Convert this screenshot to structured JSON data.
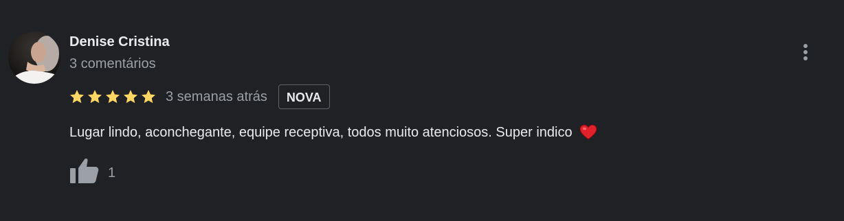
{
  "review": {
    "author_name": "Denise Cristina",
    "author_meta": "3 comentários",
    "rating": 5,
    "date": "3 semanas atrás",
    "badge": "NOVA",
    "text": "Lugar lindo, aconchegante, equipe receptiva, todos muito atenciosos. Super indico",
    "text_emoji": "heart-icon",
    "like_count": "1"
  },
  "colors": {
    "background": "#202124",
    "primary_text": "#e8eaed",
    "secondary_text": "#9aa0a6",
    "star": "#fdd663",
    "heart": "#e0202a",
    "badge_border": "#5f6368"
  },
  "icons": {
    "more": "more-vert-icon",
    "like": "thumbs-up-icon",
    "star": "star-icon"
  }
}
